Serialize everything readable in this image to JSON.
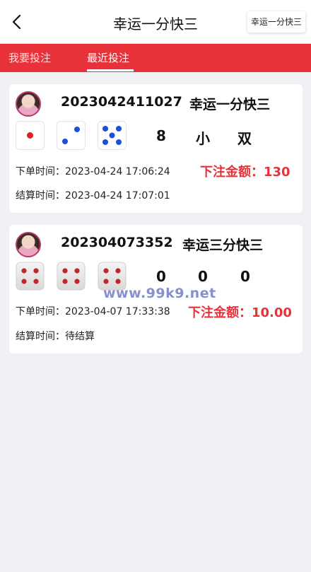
{
  "header": {
    "title": "幸运一分快三",
    "switch_label": "幸运一分快三"
  },
  "tabs": [
    {
      "label": "我要投注",
      "active": false
    },
    {
      "label": "最近投注",
      "active": true
    }
  ],
  "colors": {
    "accent": "#e7323a",
    "background": "#f0f0f5"
  },
  "bets": [
    {
      "issue": "2023042411027",
      "game": "幸运一分快三",
      "dice": [
        1,
        2,
        5
      ],
      "results": [
        "8",
        "小",
        "双"
      ],
      "order_time": "下单时间：2023-04-24 17:06:24",
      "amount": "下注金额：130",
      "settle_time": "结算时间：2023-04-24 17:07:01"
    },
    {
      "issue": "202304073352",
      "game": "幸运三分快三",
      "dice": [
        4,
        4,
        4
      ],
      "dice_style": "unsettled",
      "results": [
        "0",
        "0",
        "0"
      ],
      "order_time": "下单时间：2023-04-07 17:33:38",
      "amount": "下注金额：10.00",
      "settle_time": "结算时间：待结算"
    }
  ],
  "watermark": "www.99k9.net"
}
